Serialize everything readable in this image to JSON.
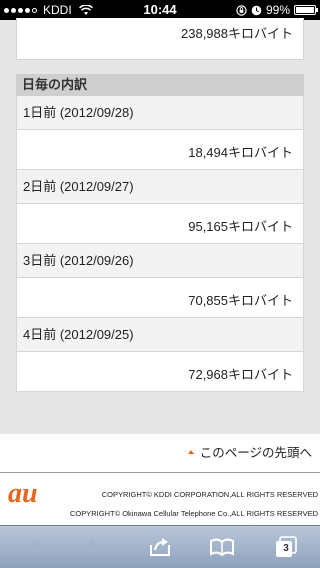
{
  "status_bar": {
    "carrier": "KDDI",
    "time": "10:44",
    "battery_percent": "99%",
    "battery_level": 0.99,
    "signal_bars": 4
  },
  "top_value": "238,988キロバイト",
  "breakdown": {
    "header": "日毎の内訳",
    "days": [
      {
        "label": "1日前 (2012/09/28)",
        "value": "18,494キロバイト"
      },
      {
        "label": "2日前 (2012/09/27)",
        "value": "95,165キロバイト"
      },
      {
        "label": "3日前 (2012/09/26)",
        "value": "70,855キロバイト"
      },
      {
        "label": "4日前 (2012/09/25)",
        "value": "72,968キロバイト"
      }
    ]
  },
  "footer": {
    "page_top_link": "このページの先頭へ",
    "logo_text": "au",
    "copyright_kddi": "COPYRIGHT© KDDI CORPORATION,ALL RIGHTS RESERVED",
    "copyright_okinawa": "COPYRIGHT© Okinawa Cellular Telephone Co.,ALL RIGHTS RESERVED"
  },
  "toolbar": {
    "tab_count": "3"
  },
  "colors": {
    "accent": "#e8651a",
    "toolbar": "#9fb0c8"
  }
}
